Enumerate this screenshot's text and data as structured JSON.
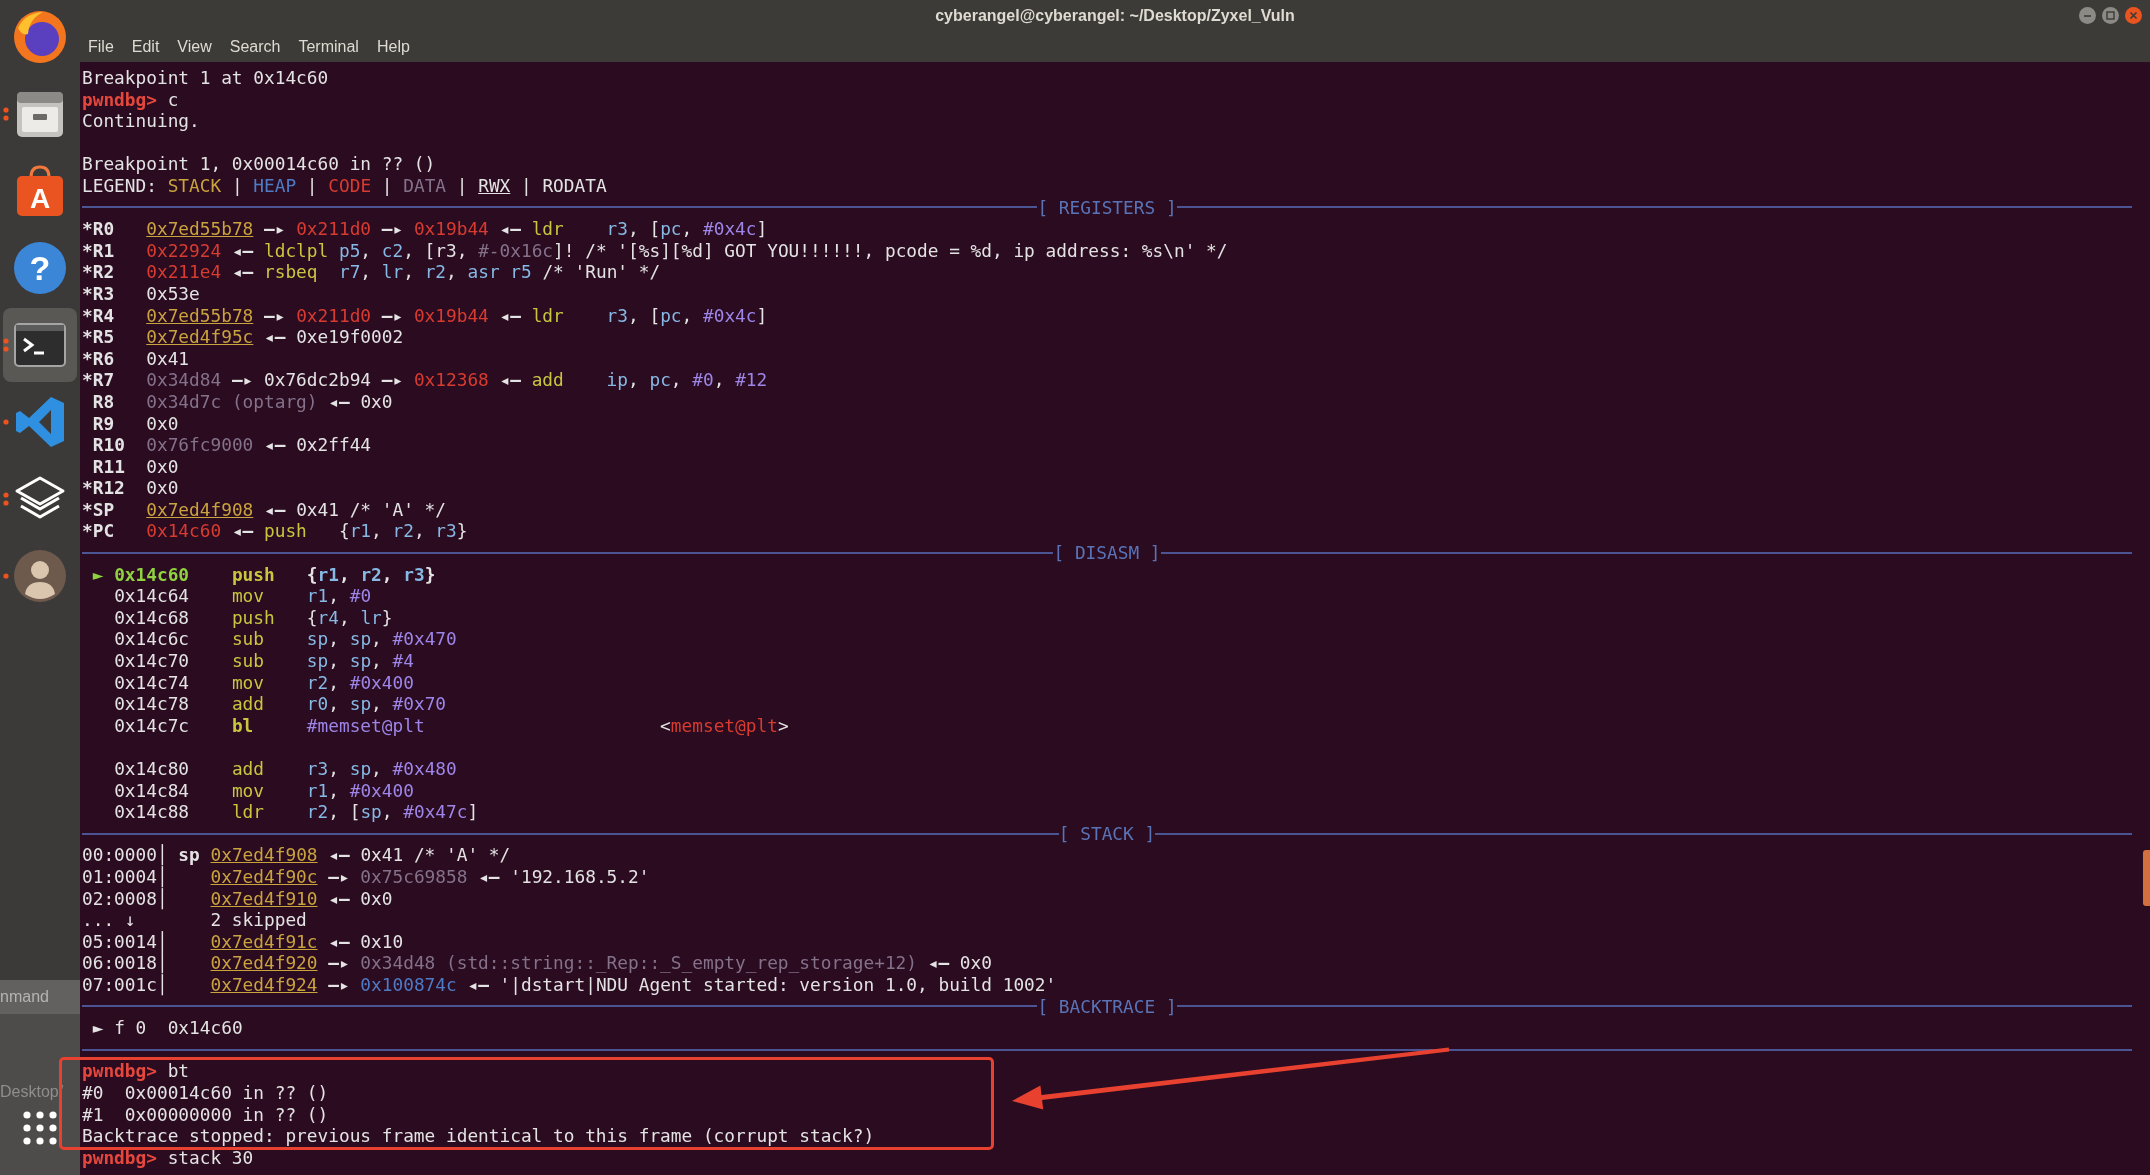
{
  "window": {
    "title": "cyberangel@cyberangel: ~/Desktop/Zyxel_Vuln"
  },
  "menu": [
    "File",
    "Edit",
    "View",
    "Search",
    "Terminal",
    "Help"
  ],
  "dock": {
    "items": [
      {
        "kind": "browser",
        "selected": false,
        "running": false,
        "multiple_windows": false
      },
      {
        "kind": "files",
        "selected": false,
        "running": true,
        "multiple_windows": true
      },
      {
        "kind": "store",
        "glyph": "A",
        "selected": false,
        "running": false,
        "multiple_windows": false
      },
      {
        "kind": "help",
        "glyph": "?",
        "selected": false,
        "running": false,
        "multiple_windows": false
      },
      {
        "kind": "terminal",
        "selected": true,
        "running": true,
        "multiple_windows": true
      },
      {
        "kind": "editor",
        "selected": false,
        "running": true,
        "multiple_windows": false
      },
      {
        "kind": "layers",
        "selected": false,
        "running": true,
        "multiple_windows": true
      },
      {
        "kind": "avatar",
        "selected": false,
        "running": true,
        "multiple_windows": false
      }
    ],
    "strip_label": "nmand",
    "behind_label": "Desktop/"
  },
  "terminal": {
    "lines": [
      {
        "kind": "output",
        "segments": [
          {
            "text": "Breakpoint 1 at 0x14c60",
            "kind": "plain"
          }
        ]
      },
      {
        "kind": "prompt",
        "segments": [
          {
            "text": "pwndbg>",
            "kind": "prompt"
          },
          {
            "text": " c",
            "kind": "plain"
          }
        ]
      },
      {
        "kind": "output",
        "segments": [
          {
            "text": "Continuing.",
            "kind": "plain"
          }
        ]
      },
      {
        "kind": "blank"
      },
      {
        "kind": "output",
        "segments": [
          {
            "text": "Breakpoint 1, 0x00014c60 in ?? ()",
            "kind": "plain"
          }
        ]
      },
      {
        "kind": "legend",
        "segments": [
          {
            "text": "LEGEND: ",
            "kind": "plain"
          },
          {
            "text": "STACK",
            "kind": "stack"
          },
          {
            "text": " | ",
            "kind": "plain"
          },
          {
            "text": "HEAP",
            "kind": "heap"
          },
          {
            "text": " | ",
            "kind": "plain"
          },
          {
            "text": "CODE",
            "kind": "code"
          },
          {
            "text": " | ",
            "kind": "plain"
          },
          {
            "text": "DATA",
            "kind": "data"
          },
          {
            "text": " | ",
            "kind": "plain"
          },
          {
            "text": "RWX",
            "kind": "rwx"
          },
          {
            "text": " | RODATA",
            "kind": "plain"
          }
        ]
      },
      {
        "kind": "section",
        "label": "[ REGISTERS ]"
      },
      {
        "kind": "register",
        "segments": [
          {
            "text": "*R0   ",
            "kind": "reg-name"
          },
          {
            "text": "0x7ed55b78",
            "kind": "stack-rwx"
          },
          {
            "text": " —▸ ",
            "kind": "arrow"
          },
          {
            "text": "0x211d0",
            "kind": "code"
          },
          {
            "text": " —▸ ",
            "kind": "arrow"
          },
          {
            "text": "0x19b44",
            "kind": "code"
          },
          {
            "text": " ◂— ",
            "kind": "arrow"
          },
          {
            "text": "ldr    ",
            "kind": "mnemonic"
          },
          {
            "text": "r3",
            "kind": "register"
          },
          {
            "text": ", [",
            "kind": "plain"
          },
          {
            "text": "pc",
            "kind": "register"
          },
          {
            "text": ", ",
            "kind": "plain"
          },
          {
            "text": "#0x4c",
            "kind": "immediate"
          },
          {
            "text": "]",
            "kind": "plain"
          }
        ]
      },
      {
        "kind": "register",
        "segments": [
          {
            "text": "*R1   ",
            "kind": "reg-name"
          },
          {
            "text": "0x22924",
            "kind": "code"
          },
          {
            "text": " ◂— ",
            "kind": "arrow"
          },
          {
            "text": "ldclpl ",
            "kind": "mnemonic"
          },
          {
            "text": "p5",
            "kind": "register"
          },
          {
            "text": ", ",
            "kind": "plain"
          },
          {
            "text": "c2",
            "kind": "register"
          },
          {
            "text": ", [r3, ",
            "kind": "plain"
          },
          {
            "text": "#-0x16c",
            "kind": "data"
          },
          {
            "text": "]! /* '[%s][%d] GOT YOU!!!!!!, pcode = %d, ip address: %s\\n' */",
            "kind": "plain"
          }
        ]
      },
      {
        "kind": "register",
        "segments": [
          {
            "text": "*R2   ",
            "kind": "reg-name"
          },
          {
            "text": "0x211e4",
            "kind": "code"
          },
          {
            "text": " ◂— ",
            "kind": "arrow"
          },
          {
            "text": "rsbeq  ",
            "kind": "mnemonic"
          },
          {
            "text": "r7",
            "kind": "register"
          },
          {
            "text": ", ",
            "kind": "plain"
          },
          {
            "text": "lr",
            "kind": "register"
          },
          {
            "text": ", ",
            "kind": "plain"
          },
          {
            "text": "r2",
            "kind": "register"
          },
          {
            "text": ", ",
            "kind": "plain"
          },
          {
            "text": "asr r5",
            "kind": "register"
          },
          {
            "text": " /* 'Run' */",
            "kind": "plain"
          }
        ]
      },
      {
        "kind": "register",
        "segments": [
          {
            "text": "*R3   ",
            "kind": "reg-name"
          },
          {
            "text": "0x53e",
            "kind": "plain"
          }
        ]
      },
      {
        "kind": "register",
        "segments": [
          {
            "text": "*R4   ",
            "kind": "reg-name"
          },
          {
            "text": "0x7ed55b78",
            "kind": "stack-rwx"
          },
          {
            "text": " —▸ ",
            "kind": "arrow"
          },
          {
            "text": "0x211d0",
            "kind": "code"
          },
          {
            "text": " —▸ ",
            "kind": "arrow"
          },
          {
            "text": "0x19b44",
            "kind": "code"
          },
          {
            "text": " ◂— ",
            "kind": "arrow"
          },
          {
            "text": "ldr    ",
            "kind": "mnemonic"
          },
          {
            "text": "r3",
            "kind": "register"
          },
          {
            "text": ", [",
            "kind": "plain"
          },
          {
            "text": "pc",
            "kind": "register"
          },
          {
            "text": ", ",
            "kind": "plain"
          },
          {
            "text": "#0x4c",
            "kind": "immediate"
          },
          {
            "text": "]",
            "kind": "plain"
          }
        ]
      },
      {
        "kind": "register",
        "segments": [
          {
            "text": "*R5   ",
            "kind": "reg-name"
          },
          {
            "text": "0x7ed4f95c",
            "kind": "stack-rwx"
          },
          {
            "text": " ◂— ",
            "kind": "arrow"
          },
          {
            "text": "0xe19f0002",
            "kind": "plain"
          }
        ]
      },
      {
        "kind": "register",
        "segments": [
          {
            "text": "*R6   ",
            "kind": "reg-name"
          },
          {
            "text": "0x41",
            "kind": "plain"
          }
        ]
      },
      {
        "kind": "register",
        "segments": [
          {
            "text": "*R7   ",
            "kind": "reg-name"
          },
          {
            "text": "0x34d84",
            "kind": "data"
          },
          {
            "text": " —▸ ",
            "kind": "arrow"
          },
          {
            "text": "0x76dc2b94",
            "kind": "plain"
          },
          {
            "text": " —▸ ",
            "kind": "arrow"
          },
          {
            "text": "0x12368",
            "kind": "code"
          },
          {
            "text": " ◂— ",
            "kind": "arrow"
          },
          {
            "text": "add    ",
            "kind": "mnemonic"
          },
          {
            "text": "ip",
            "kind": "register"
          },
          {
            "text": ", ",
            "kind": "plain"
          },
          {
            "text": "pc",
            "kind": "register"
          },
          {
            "text": ", ",
            "kind": "plain"
          },
          {
            "text": "#0",
            "kind": "immediate"
          },
          {
            "text": ", ",
            "kind": "plain"
          },
          {
            "text": "#12",
            "kind": "immediate"
          }
        ]
      },
      {
        "kind": "register",
        "segments": [
          {
            "text": " R8   ",
            "kind": "reg-name"
          },
          {
            "text": "0x34d7c (optarg)",
            "kind": "data"
          },
          {
            "text": " ◂— ",
            "kind": "arrow"
          },
          {
            "text": "0x0",
            "kind": "plain"
          }
        ]
      },
      {
        "kind": "register",
        "segments": [
          {
            "text": " R9   ",
            "kind": "reg-name"
          },
          {
            "text": "0x0",
            "kind": "plain"
          }
        ]
      },
      {
        "kind": "register",
        "segments": [
          {
            "text": " R10  ",
            "kind": "reg-name"
          },
          {
            "text": "0x76fc9000",
            "kind": "data"
          },
          {
            "text": " ◂— ",
            "kind": "arrow"
          },
          {
            "text": "0x2ff44",
            "kind": "plain"
          }
        ]
      },
      {
        "kind": "register",
        "segments": [
          {
            "text": " R11  ",
            "kind": "reg-name"
          },
          {
            "text": "0x0",
            "kind": "plain"
          }
        ]
      },
      {
        "kind": "register",
        "segments": [
          {
            "text": "*R12  ",
            "kind": "reg-name"
          },
          {
            "text": "0x0",
            "kind": "plain"
          }
        ]
      },
      {
        "kind": "register",
        "segments": [
          {
            "text": "*SP   ",
            "kind": "reg-name"
          },
          {
            "text": "0x7ed4f908",
            "kind": "stack-rwx"
          },
          {
            "text": " ◂— ",
            "kind": "arrow"
          },
          {
            "text": "0x41 /* 'A' */",
            "kind": "plain"
          }
        ]
      },
      {
        "kind": "register",
        "segments": [
          {
            "text": "*PC   ",
            "kind": "reg-name"
          },
          {
            "text": "0x14c60",
            "kind": "code"
          },
          {
            "text": " ◂— ",
            "kind": "arrow"
          },
          {
            "text": "push   ",
            "kind": "mnemonic"
          },
          {
            "text": "{",
            "kind": "plain"
          },
          {
            "text": "r1",
            "kind": "register"
          },
          {
            "text": ", ",
            "kind": "plain"
          },
          {
            "text": "r2",
            "kind": "register"
          },
          {
            "text": ", ",
            "kind": "plain"
          },
          {
            "text": "r3",
            "kind": "register"
          },
          {
            "text": "}",
            "kind": "plain"
          }
        ]
      },
      {
        "kind": "section",
        "label": "[ DISASM ]"
      },
      {
        "kind": "disasm",
        "segments": [
          {
            "text": " ► ",
            "kind": "current"
          },
          {
            "text": "0x14c60    ",
            "kind": "current"
          },
          {
            "text": "push   ",
            "kind": "mnemonic-bold"
          },
          {
            "text": "{",
            "kind": "bold"
          },
          {
            "text": "r1",
            "kind": "register-bold"
          },
          {
            "text": ", ",
            "kind": "bold"
          },
          {
            "text": "r2",
            "kind": "register-bold"
          },
          {
            "text": ", ",
            "kind": "bold"
          },
          {
            "text": "r3",
            "kind": "register-bold"
          },
          {
            "text": "}",
            "kind": "bold"
          }
        ]
      },
      {
        "kind": "disasm",
        "segments": [
          {
            "text": "   0x14c64    ",
            "kind": "plain"
          },
          {
            "text": "mov    ",
            "kind": "mnemonic"
          },
          {
            "text": "r1",
            "kind": "register"
          },
          {
            "text": ", ",
            "kind": "plain"
          },
          {
            "text": "#0",
            "kind": "immediate"
          }
        ]
      },
      {
        "kind": "disasm",
        "segments": [
          {
            "text": "   0x14c68    ",
            "kind": "plain"
          },
          {
            "text": "push   ",
            "kind": "mnemonic"
          },
          {
            "text": "{",
            "kind": "plain"
          },
          {
            "text": "r4",
            "kind": "register"
          },
          {
            "text": ", ",
            "kind": "plain"
          },
          {
            "text": "lr",
            "kind": "register"
          },
          {
            "text": "}",
            "kind": "plain"
          }
        ]
      },
      {
        "kind": "disasm",
        "segments": [
          {
            "text": "   0x14c6c    ",
            "kind": "plain"
          },
          {
            "text": "sub    ",
            "kind": "mnemonic"
          },
          {
            "text": "sp",
            "kind": "register"
          },
          {
            "text": ", ",
            "kind": "plain"
          },
          {
            "text": "sp",
            "kind": "register"
          },
          {
            "text": ", ",
            "kind": "plain"
          },
          {
            "text": "#0x470",
            "kind": "immediate"
          }
        ]
      },
      {
        "kind": "disasm",
        "segments": [
          {
            "text": "   0x14c70    ",
            "kind": "plain"
          },
          {
            "text": "sub    ",
            "kind": "mnemonic"
          },
          {
            "text": "sp",
            "kind": "register"
          },
          {
            "text": ", ",
            "kind": "plain"
          },
          {
            "text": "sp",
            "kind": "register"
          },
          {
            "text": ", ",
            "kind": "plain"
          },
          {
            "text": "#4",
            "kind": "immediate"
          }
        ]
      },
      {
        "kind": "disasm",
        "segments": [
          {
            "text": "   0x14c74    ",
            "kind": "plain"
          },
          {
            "text": "mov    ",
            "kind": "mnemonic"
          },
          {
            "text": "r2",
            "kind": "register"
          },
          {
            "text": ", ",
            "kind": "plain"
          },
          {
            "text": "#0x400",
            "kind": "immediate"
          }
        ]
      },
      {
        "kind": "disasm",
        "segments": [
          {
            "text": "   0x14c78    ",
            "kind": "plain"
          },
          {
            "text": "add    ",
            "kind": "mnemonic"
          },
          {
            "text": "r0",
            "kind": "register"
          },
          {
            "text": ", ",
            "kind": "plain"
          },
          {
            "text": "sp",
            "kind": "register"
          },
          {
            "text": ", ",
            "kind": "plain"
          },
          {
            "text": "#0x70",
            "kind": "immediate"
          }
        ]
      },
      {
        "kind": "disasm",
        "segments": [
          {
            "text": "   0x14c7c    ",
            "kind": "plain"
          },
          {
            "text": "bl     ",
            "kind": "mnemonic-bold"
          },
          {
            "text": "#memset@plt",
            "kind": "immediate"
          },
          {
            "text": "                      <",
            "kind": "plain"
          },
          {
            "text": "memset@plt",
            "kind": "code"
          },
          {
            "text": ">",
            "kind": "plain"
          }
        ]
      },
      {
        "kind": "blank"
      },
      {
        "kind": "disasm",
        "segments": [
          {
            "text": "   0x14c80    ",
            "kind": "plain"
          },
          {
            "text": "add    ",
            "kind": "mnemonic"
          },
          {
            "text": "r3",
            "kind": "register"
          },
          {
            "text": ", ",
            "kind": "plain"
          },
          {
            "text": "sp",
            "kind": "register"
          },
          {
            "text": ", ",
            "kind": "plain"
          },
          {
            "text": "#0x480",
            "kind": "immediate"
          }
        ]
      },
      {
        "kind": "disasm",
        "segments": [
          {
            "text": "   0x14c84    ",
            "kind": "plain"
          },
          {
            "text": "mov    ",
            "kind": "mnemonic"
          },
          {
            "text": "r1",
            "kind": "register"
          },
          {
            "text": ", ",
            "kind": "plain"
          },
          {
            "text": "#0x400",
            "kind": "immediate"
          }
        ]
      },
      {
        "kind": "disasm",
        "segments": [
          {
            "text": "   0x14c88    ",
            "kind": "plain"
          },
          {
            "text": "ldr    ",
            "kind": "mnemonic"
          },
          {
            "text": "r2",
            "kind": "register"
          },
          {
            "text": ", [",
            "kind": "plain"
          },
          {
            "text": "sp",
            "kind": "register"
          },
          {
            "text": ", ",
            "kind": "plain"
          },
          {
            "text": "#0x47c",
            "kind": "immediate"
          },
          {
            "text": "]",
            "kind": "plain"
          }
        ]
      },
      {
        "kind": "section",
        "label": "[ STACK ]"
      },
      {
        "kind": "stack",
        "segments": [
          {
            "text": "00:0000│ ",
            "kind": "plain"
          },
          {
            "text": "sp ",
            "kind": "bold"
          },
          {
            "text": "0x7ed4f908",
            "kind": "stack-rwx"
          },
          {
            "text": " ◂— ",
            "kind": "arrow"
          },
          {
            "text": "0x41 /* 'A' */",
            "kind": "plain"
          }
        ]
      },
      {
        "kind": "stack",
        "segments": [
          {
            "text": "01:0004│    ",
            "kind": "plain"
          },
          {
            "text": "0x7ed4f90c",
            "kind": "stack-rwx"
          },
          {
            "text": " —▸ ",
            "kind": "arrow"
          },
          {
            "text": "0x75c69858",
            "kind": "data"
          },
          {
            "text": " ◂— ",
            "kind": "arrow"
          },
          {
            "text": "'192.168.5.2'",
            "kind": "plain"
          }
        ]
      },
      {
        "kind": "stack",
        "segments": [
          {
            "text": "02:0008│    ",
            "kind": "plain"
          },
          {
            "text": "0x7ed4f910",
            "kind": "stack-rwx"
          },
          {
            "text": " ◂— ",
            "kind": "arrow"
          },
          {
            "text": "0x0",
            "kind": "plain"
          }
        ]
      },
      {
        "kind": "stack",
        "segments": [
          {
            "text": "... ↓       2 skipped",
            "kind": "plain"
          }
        ]
      },
      {
        "kind": "stack",
        "segments": [
          {
            "text": "05:0014│    ",
            "kind": "plain"
          },
          {
            "text": "0x7ed4f91c",
            "kind": "stack-rwx"
          },
          {
            "text": " ◂— ",
            "kind": "arrow"
          },
          {
            "text": "0x10",
            "kind": "plain"
          }
        ]
      },
      {
        "kind": "stack",
        "segments": [
          {
            "text": "06:0018│    ",
            "kind": "plain"
          },
          {
            "text": "0x7ed4f920",
            "kind": "stack-rwx"
          },
          {
            "text": " —▸ ",
            "kind": "arrow"
          },
          {
            "text": "0x34d48 (std::string::_Rep::_S_empty_rep_storage+12)",
            "kind": "data"
          },
          {
            "text": " ◂— ",
            "kind": "arrow"
          },
          {
            "text": "0x0",
            "kind": "plain"
          }
        ]
      },
      {
        "kind": "stack",
        "segments": [
          {
            "text": "07:001c│    ",
            "kind": "plain"
          },
          {
            "text": "0x7ed4f924",
            "kind": "stack-rwx"
          },
          {
            "text": " —▸ ",
            "kind": "arrow"
          },
          {
            "text": "0x100874c",
            "kind": "heap"
          },
          {
            "text": " ◂— ",
            "kind": "arrow"
          },
          {
            "text": "'|dstart|NDU Agent started: version 1.0, build 1002'",
            "kind": "plain"
          }
        ]
      },
      {
        "kind": "section",
        "label": "[ BACKTRACE ]"
      },
      {
        "kind": "backtrace",
        "segments": [
          {
            "text": " ► f 0  0x14c60",
            "kind": "plain"
          }
        ]
      },
      {
        "kind": "rule"
      },
      {
        "kind": "prompt",
        "segments": [
          {
            "text": "pwndbg>",
            "kind": "prompt"
          },
          {
            "text": " bt",
            "kind": "plain"
          }
        ]
      },
      {
        "kind": "output",
        "segments": [
          {
            "text": "#0  0x00014c60 in ?? ()",
            "kind": "plain"
          }
        ]
      },
      {
        "kind": "output",
        "segments": [
          {
            "text": "#1  0x00000000 in ?? ()",
            "kind": "plain"
          }
        ]
      },
      {
        "kind": "output",
        "segments": [
          {
            "text": "Backtrace stopped: previous frame identical to this frame (corrupt stack?)",
            "kind": "plain"
          }
        ]
      },
      {
        "kind": "prompt",
        "segments": [
          {
            "text": "pwndbg>",
            "kind": "prompt"
          },
          {
            "text": " stack 30",
            "kind": "plain"
          }
        ]
      }
    ]
  }
}
